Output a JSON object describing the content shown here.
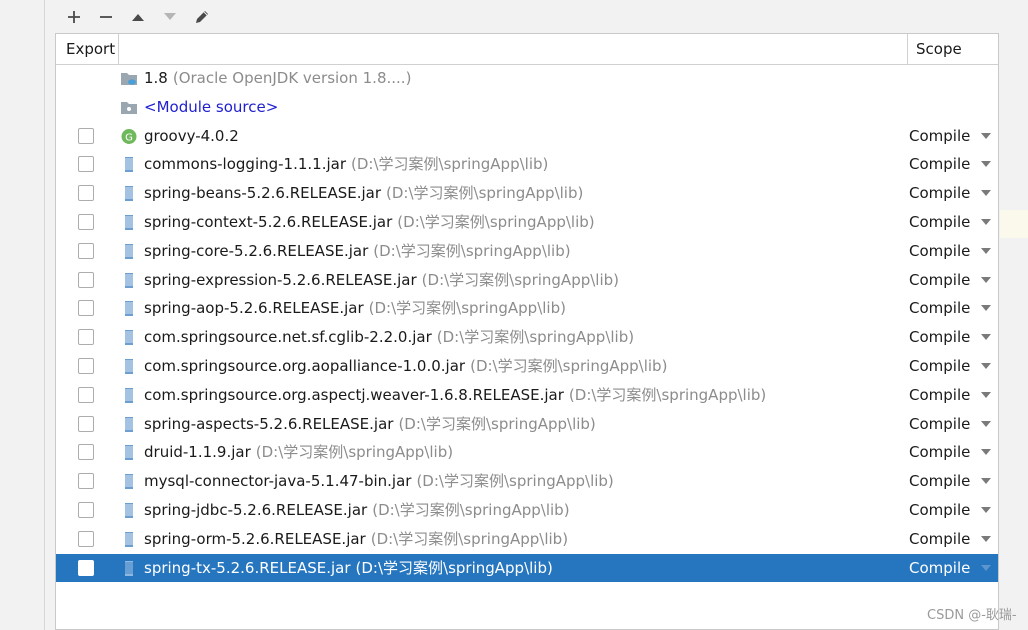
{
  "header": {
    "export_label": "Export",
    "scope_label": "Scope"
  },
  "toolbar": {
    "add_icon": "plus-icon",
    "remove_icon": "minus-icon",
    "up_icon": "arrow-up-icon",
    "down_icon": "arrow-down-icon",
    "edit_icon": "pencil-icon"
  },
  "sdk_row": {
    "name": "1.8",
    "detail": "(Oracle OpenJDK version 1.8....)"
  },
  "module_row": {
    "name": "<Module source>"
  },
  "groovy_row": {
    "name": "groovy-4.0.2",
    "scope": "Compile",
    "icon_letter": "G"
  },
  "libs": [
    {
      "name": "commons-logging-1.1.1.jar",
      "path": "(D:\\学习案例\\springApp\\lib)",
      "scope": "Compile"
    },
    {
      "name": "spring-beans-5.2.6.RELEASE.jar",
      "path": "(D:\\学习案例\\springApp\\lib)",
      "scope": "Compile"
    },
    {
      "name": "spring-context-5.2.6.RELEASE.jar",
      "path": "(D:\\学习案例\\springApp\\lib)",
      "scope": "Compile"
    },
    {
      "name": "spring-core-5.2.6.RELEASE.jar",
      "path": "(D:\\学习案例\\springApp\\lib)",
      "scope": "Compile"
    },
    {
      "name": "spring-expression-5.2.6.RELEASE.jar",
      "path": "(D:\\学习案例\\springApp\\lib)",
      "scope": "Compile"
    },
    {
      "name": "spring-aop-5.2.6.RELEASE.jar",
      "path": "(D:\\学习案例\\springApp\\lib)",
      "scope": "Compile"
    },
    {
      "name": "com.springsource.net.sf.cglib-2.2.0.jar",
      "path": "(D:\\学习案例\\springApp\\lib)",
      "scope": "Compile"
    },
    {
      "name": "com.springsource.org.aopalliance-1.0.0.jar",
      "path": "(D:\\学习案例\\springApp\\lib)",
      "scope": "Compile"
    },
    {
      "name": "com.springsource.org.aspectj.weaver-1.6.8.RELEASE.jar",
      "path": "(D:\\学习案例\\springApp\\lib)",
      "scope": "Compile"
    },
    {
      "name": "spring-aspects-5.2.6.RELEASE.jar",
      "path": "(D:\\学习案例\\springApp\\lib)",
      "scope": "Compile"
    },
    {
      "name": "druid-1.1.9.jar",
      "path": "(D:\\学习案例\\springApp\\lib)",
      "scope": "Compile"
    },
    {
      "name": "mysql-connector-java-5.1.47-bin.jar",
      "path": "(D:\\学习案例\\springApp\\lib)",
      "scope": "Compile"
    },
    {
      "name": "spring-jdbc-5.2.6.RELEASE.jar",
      "path": "(D:\\学习案例\\springApp\\lib)",
      "scope": "Compile"
    },
    {
      "name": "spring-orm-5.2.6.RELEASE.jar",
      "path": "(D:\\学习案例\\springApp\\lib)",
      "scope": "Compile"
    },
    {
      "name": "spring-tx-5.2.6.RELEASE.jar",
      "path": "(D:\\学习案例\\springApp\\lib)",
      "scope": "Compile",
      "selected": true
    }
  ],
  "watermark": "CSDN @-耿瑞-",
  "colors": {
    "selection": "#2675bf",
    "link": "#2020d0",
    "path_gray": "#8c8c8c",
    "groovy_green": "#6fb85c",
    "jar_blue": "#6c9ed1"
  }
}
